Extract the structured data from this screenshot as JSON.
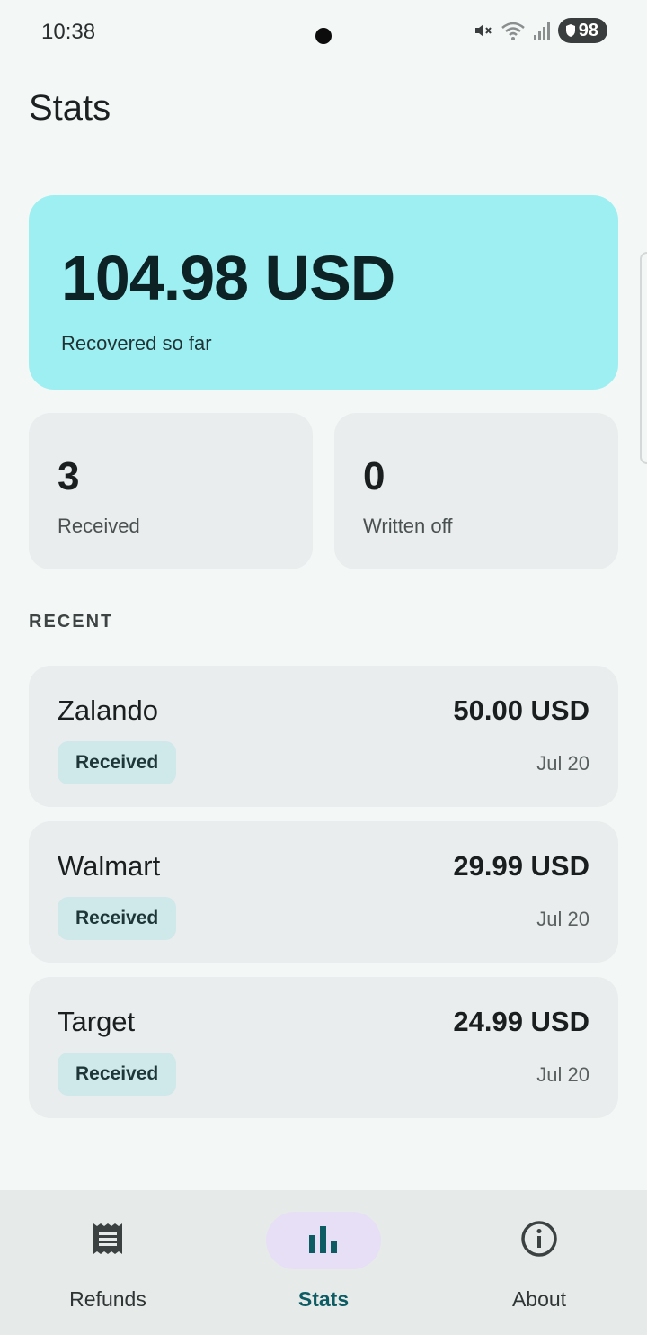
{
  "status_bar": {
    "time": "10:38",
    "battery": "98"
  },
  "header": {
    "title": "Stats"
  },
  "summary": {
    "total_amount": "104.98 USD",
    "total_label": "Recovered so far",
    "received_count": "3",
    "received_label": "Received",
    "written_off_count": "0",
    "written_off_label": "Written off"
  },
  "recent": {
    "section_label": "RECENT",
    "items": [
      {
        "merchant": "Zalando",
        "amount": "50.00 USD",
        "status": "Received",
        "date": "Jul 20"
      },
      {
        "merchant": "Walmart",
        "amount": "29.99 USD",
        "status": "Received",
        "date": "Jul 20"
      },
      {
        "merchant": "Target",
        "amount": "24.99 USD",
        "status": "Received",
        "date": "Jul 20"
      }
    ]
  },
  "bottom_nav": {
    "items": [
      {
        "label": "Refunds",
        "icon": "receipt-icon",
        "active": false
      },
      {
        "label": "Stats",
        "icon": "bar-chart-icon",
        "active": true
      },
      {
        "label": "About",
        "icon": "info-icon",
        "active": false
      }
    ]
  },
  "colors": {
    "hero_background": "#9eeff2",
    "active_accent": "#0d5c63",
    "active_pill": "#e7dff5",
    "badge_background": "#cfe8ea"
  }
}
